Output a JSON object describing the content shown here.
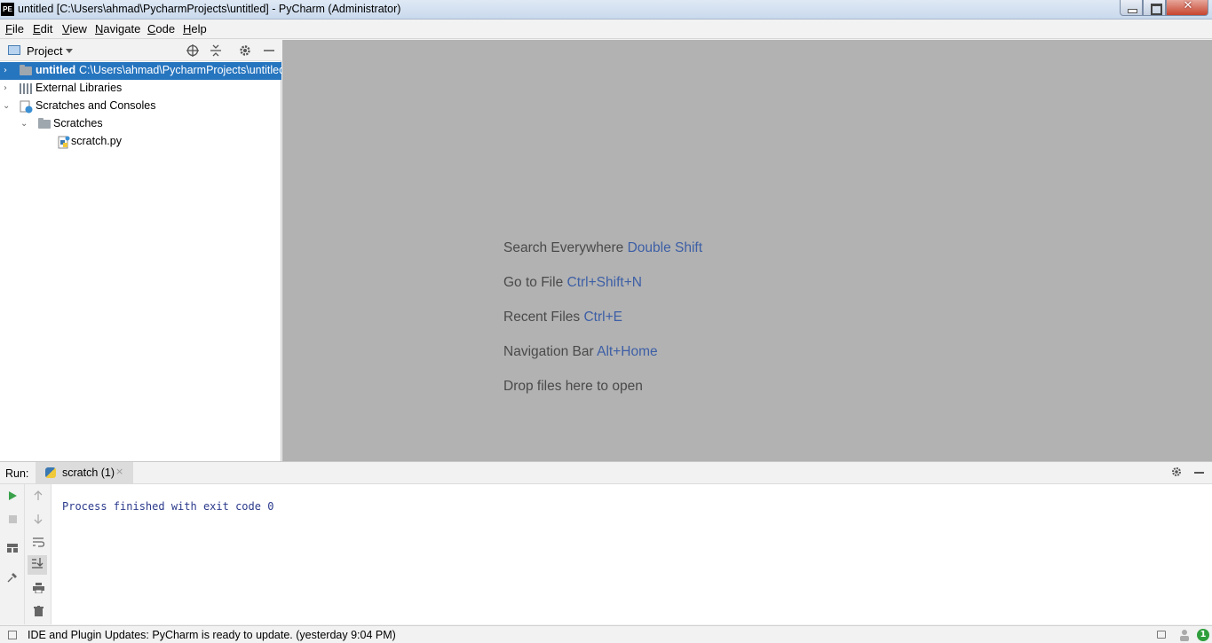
{
  "window": {
    "logo": "PE",
    "title": "untitled [C:\\Users\\ahmad\\PycharmProjects\\untitled] - PyCharm (Administrator)",
    "close_glyph": "✕"
  },
  "menu": {
    "items": [
      "File",
      "Edit",
      "View",
      "Navigate",
      "Code",
      "Help"
    ]
  },
  "project": {
    "title": "Project",
    "tree": [
      {
        "label": "untitled",
        "path": "C:\\Users\\ahmad\\PycharmProjects\\untitled",
        "chevron": "›",
        "icon": "folder-icon",
        "selected": true
      },
      {
        "label": "External Libraries",
        "chevron": "›",
        "icon": "libraries-icon"
      },
      {
        "label": "Scratches and Consoles",
        "chevron": "⌄",
        "icon": "scratches-icon"
      },
      {
        "label": "Scratches",
        "chevron": "⌄",
        "icon": "folder-icon"
      },
      {
        "label": "scratch.py",
        "icon": "python-file-icon"
      }
    ]
  },
  "editor": {
    "hints": [
      {
        "text": "Search Everywhere",
        "key": "Double Shift"
      },
      {
        "text": "Go to File",
        "key": "Ctrl+Shift+N"
      },
      {
        "text": "Recent Files",
        "key": "Ctrl+E"
      },
      {
        "text": "Navigation Bar",
        "key": "Alt+Home"
      },
      {
        "text": "Drop files here to open",
        "key": ""
      }
    ]
  },
  "run": {
    "label": "Run:",
    "tab_label": "scratch (1)",
    "tab_close": "×",
    "console_output": "Process finished with exit code 0"
  },
  "status": {
    "text": "IDE and Plugin Updates: PyCharm is ready to update. (yesterday 9:04 PM)",
    "badge_count": "1"
  },
  "colors": {
    "selection": "#2675bf",
    "editor_bg": "#b2b2b2",
    "shortcut_key": "#3d5fa6",
    "console_text": "#2b3a8c"
  }
}
